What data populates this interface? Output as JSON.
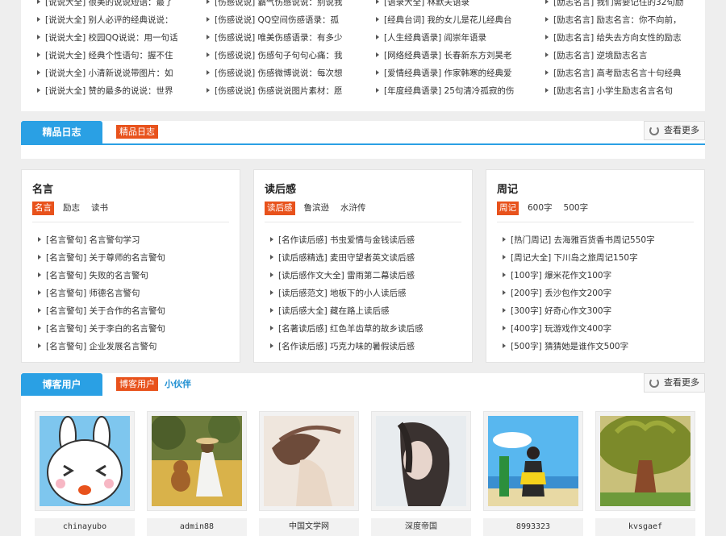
{
  "top_list": {
    "columns": [
      [
        "[说说大全] 很美的说说短语：最了",
        "[说说大全] 别人必评的经典说说：",
        "[说说大全] 校园QQ说说：用一句话",
        "[说说大全] 经典个性语句：握不住",
        "[说说大全] 小清新说说带图片：如",
        "[说说大全] 赞的最多的说说：世界"
      ],
      [
        "[伤感说说] 霸气伤感说说：别说我",
        "[伤感说说] QQ空间伤感语录：孤",
        "[伤感说说] 唯美伤感语录：有多少",
        "[伤感说说] 伤感句子句句心痛：我",
        "[伤感说说] 伤感微博说说：每次想",
        "[伤感说说] 伤感说说图片素材：愿"
      ],
      [
        "[语录大全] 林默夫语录",
        "[经典台词] 我的女儿是花儿经典台",
        "[人生经典语录] 阎崇年语录",
        "[网络经典语录] 长春新东方刘昊老",
        "[爱情经典语录] 作家韩寒的经典爱",
        "[年度经典语录] 25句清冷孤寂的伤"
      ],
      [
        "[励志名言] 我们需要记住的32句励",
        "[励志名言] 励志名言：你不向前，",
        "[励志名言] 给失去方向女性的励志",
        "[励志名言] 逆境励志名言",
        "[励志名言] 高考励志名言十句经典",
        "[励志名言] 小学生励志名言名句"
      ]
    ]
  },
  "section_log": {
    "tab": "精品日志",
    "badge": "精品日志",
    "more": "查看更多"
  },
  "cards": [
    {
      "title": "名言",
      "tabs": [
        "名言",
        "励志",
        "读书"
      ],
      "items": [
        "[名言警句] 名言警句学习",
        "[名言警句] 关于尊师的名言警句",
        "[名言警句] 失败的名言警句",
        "[名言警句] 师德名言警句",
        "[名言警句] 关于合作的名言警句",
        "[名言警句] 关于李白的名言警句",
        "[名言警句] 企业发展名言警句"
      ]
    },
    {
      "title": "读后感",
      "tabs": [
        "读后感",
        "鲁滨逊",
        "水浒传"
      ],
      "items": [
        "[名作读后感] 书虫爱情与金钱读后感",
        "[读后感精选] 麦田守望者英文读后感",
        "[读后感作文大全] 雷雨第二幕读后感",
        "[读后感范文] 地板下的小人读后感",
        "[读后感大全] 藏在路上读后感",
        "[名著读后感] 红色羊齿草的故乡读后感",
        "[名作读后感] 巧克力味的暑假读后感"
      ]
    },
    {
      "title": "周记",
      "tabs": [
        "周记",
        "600字",
        "500字"
      ],
      "items": [
        "[热门周记] 去海雅百货香书周记550字",
        "[周记大全] 下川岛之旅周记150字",
        "[100字] 爆米花作文100字",
        "[200字] 丢沙包作文200字",
        "[300字] 好奇心作文300字",
        "[400字] 玩游戏作文400字",
        "[500字] 猜猜她是谁作文500字"
      ]
    }
  ],
  "section_users": {
    "tab": "博客用户",
    "badge": "博客用户",
    "sub": "小伙伴",
    "more": "查看更多"
  },
  "users": [
    {
      "name": "chinayubo",
      "avatar": "bunny-cartoon-avatar"
    },
    {
      "name": "admin88",
      "avatar": "girl-teddy-bear-field-avatar"
    },
    {
      "name": "中国文学网",
      "avatar": "girl-windblown-hair-avatar"
    },
    {
      "name": "深度帝国",
      "avatar": "girl-portrait-avatar"
    },
    {
      "name": "8993323",
      "avatar": "girl-beach-sky-avatar"
    },
    {
      "name": "kvsgaef",
      "avatar": "painted-tree-avatar"
    }
  ]
}
